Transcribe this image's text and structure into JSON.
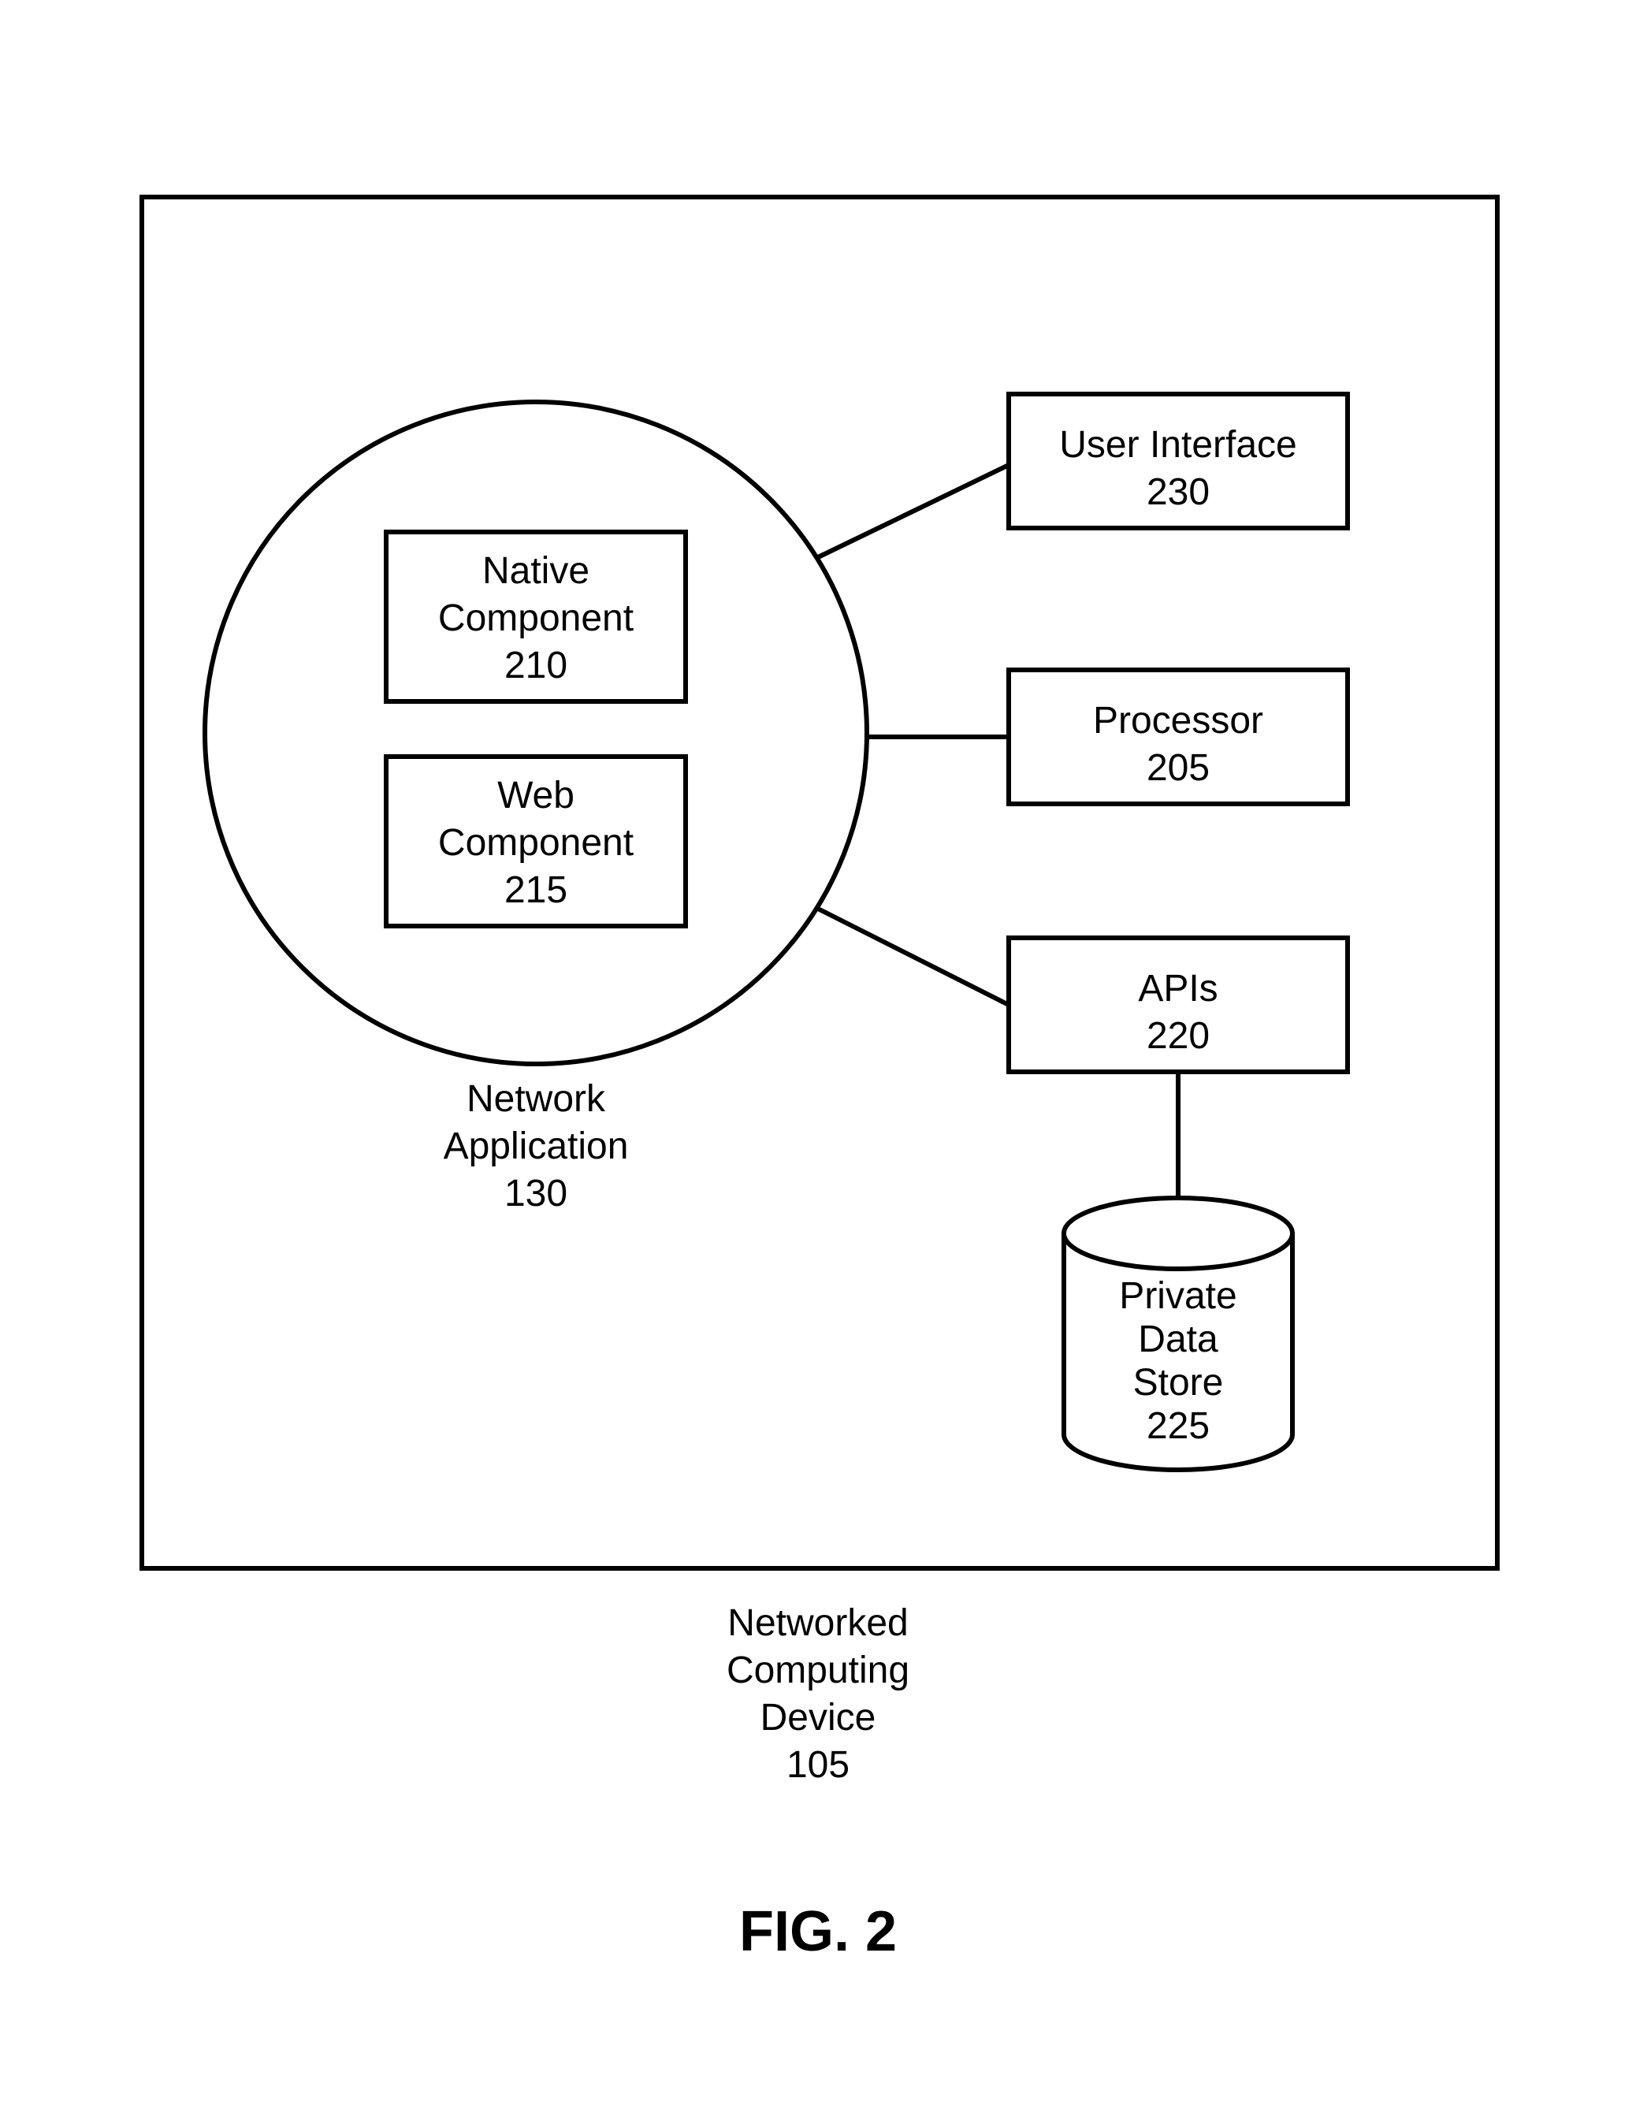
{
  "components": {
    "networkApp": {
      "title": "Network",
      "subtitle": "Application",
      "num": "130"
    },
    "nativeComponent": {
      "line1": "Native",
      "line2": "Component",
      "num": "210"
    },
    "webComponent": {
      "line1": "Web",
      "line2": "Component",
      "num": "215"
    },
    "userInterface": {
      "line1": "User Interface",
      "num": "230"
    },
    "processor": {
      "line1": "Processor",
      "num": "205"
    },
    "apis": {
      "line1": "APIs",
      "num": "220"
    },
    "dataStore": {
      "line1": "Private",
      "line2": "Data",
      "line3": "Store",
      "num": "225"
    },
    "device": {
      "line1": "Networked",
      "line2": "Computing",
      "line3": "Device",
      "num": "105"
    }
  },
  "figure": {
    "label": "FIG. 2"
  }
}
